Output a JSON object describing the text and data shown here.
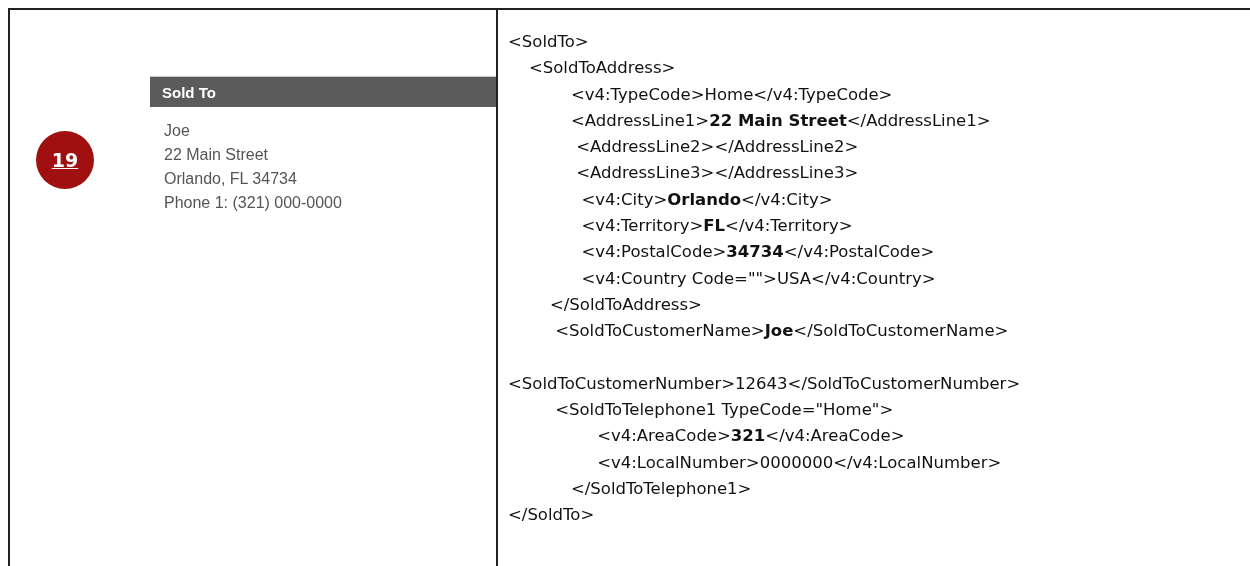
{
  "badge": "19",
  "preview": {
    "header": "Sold To",
    "lines": [
      "Joe",
      "22 Main Street",
      "Orlando, FL 34734",
      "Phone 1: (321) 000-0000"
    ]
  },
  "xml_lines": [
    {
      "kind": "code",
      "text": "<SoldTo>"
    },
    {
      "kind": "code",
      "text": "    <SoldToAddress>"
    },
    {
      "kind": "code",
      "text": "            <v4:TypeCode>Home</v4:TypeCode>"
    },
    {
      "kind": "code",
      "text": "            <AddressLine1>**22 Main Street**</AddressLine1>"
    },
    {
      "kind": "code",
      "text": "             <AddressLine2></AddressLine2>"
    },
    {
      "kind": "code",
      "text": "             <AddressLine3></AddressLine3>"
    },
    {
      "kind": "code",
      "text": "              <v4:City>**Orlando**</v4:City>"
    },
    {
      "kind": "code",
      "text": "              <v4:Territory>**FL**</v4:Territory>"
    },
    {
      "kind": "code",
      "text": "              <v4:PostalCode>**34734**</v4:PostalCode>"
    },
    {
      "kind": "code",
      "text": "              <v4:Country Code=\"\">USA</v4:Country>"
    },
    {
      "kind": "code",
      "text": "        </SoldToAddress>"
    },
    {
      "kind": "code",
      "text": "         <SoldToCustomerName>**Joe**</SoldToCustomerName>"
    },
    {
      "kind": "blank"
    },
    {
      "kind": "code",
      "text": "<SoldToCustomerNumber>12643</SoldToCustomerNumber>"
    },
    {
      "kind": "code",
      "text": "         <SoldToTelephone1 TypeCode=\"Home\">"
    },
    {
      "kind": "code",
      "text": "                 <v4:AreaCode>**321**</v4:AreaCode>"
    },
    {
      "kind": "code",
      "text": "                 <v4:LocalNumber>0000000</v4:LocalNumber>"
    },
    {
      "kind": "code",
      "text": "            </SoldToTelephone1>"
    },
    {
      "kind": "code",
      "text": "</SoldTo>"
    }
  ]
}
